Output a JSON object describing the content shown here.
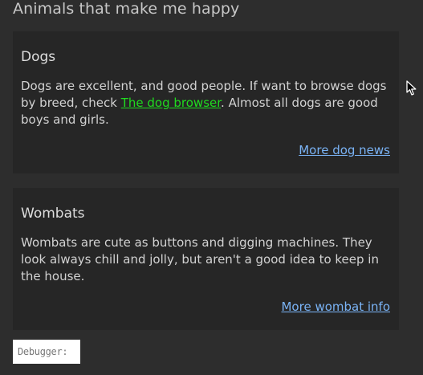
{
  "page": {
    "title": "Animals that make me happy"
  },
  "cards": {
    "dogs": {
      "title": "Dogs",
      "text_before_link": "Dogs are excellent, and good people. If want to browse dogs by breed, check ",
      "link_text": "The dog browser",
      "text_after_link": ". Almost all dogs are good boys and girls.",
      "footer_link": "More dog news"
    },
    "wombats": {
      "title": "Wombats",
      "text": "Wombats are cute as buttons and digging machines. They look always chill and jolly, but aren't a good idea to keep in the house.",
      "footer_link": "More wombat info"
    }
  },
  "debugger": {
    "label": "Debugger:"
  },
  "colors": {
    "background": "#2d2d2d",
    "card_background": "#262626",
    "inline_link": "#1fdc1f",
    "footer_link": "#7ab3f5"
  },
  "icons": {
    "cursor": "mouse-pointer-icon"
  }
}
